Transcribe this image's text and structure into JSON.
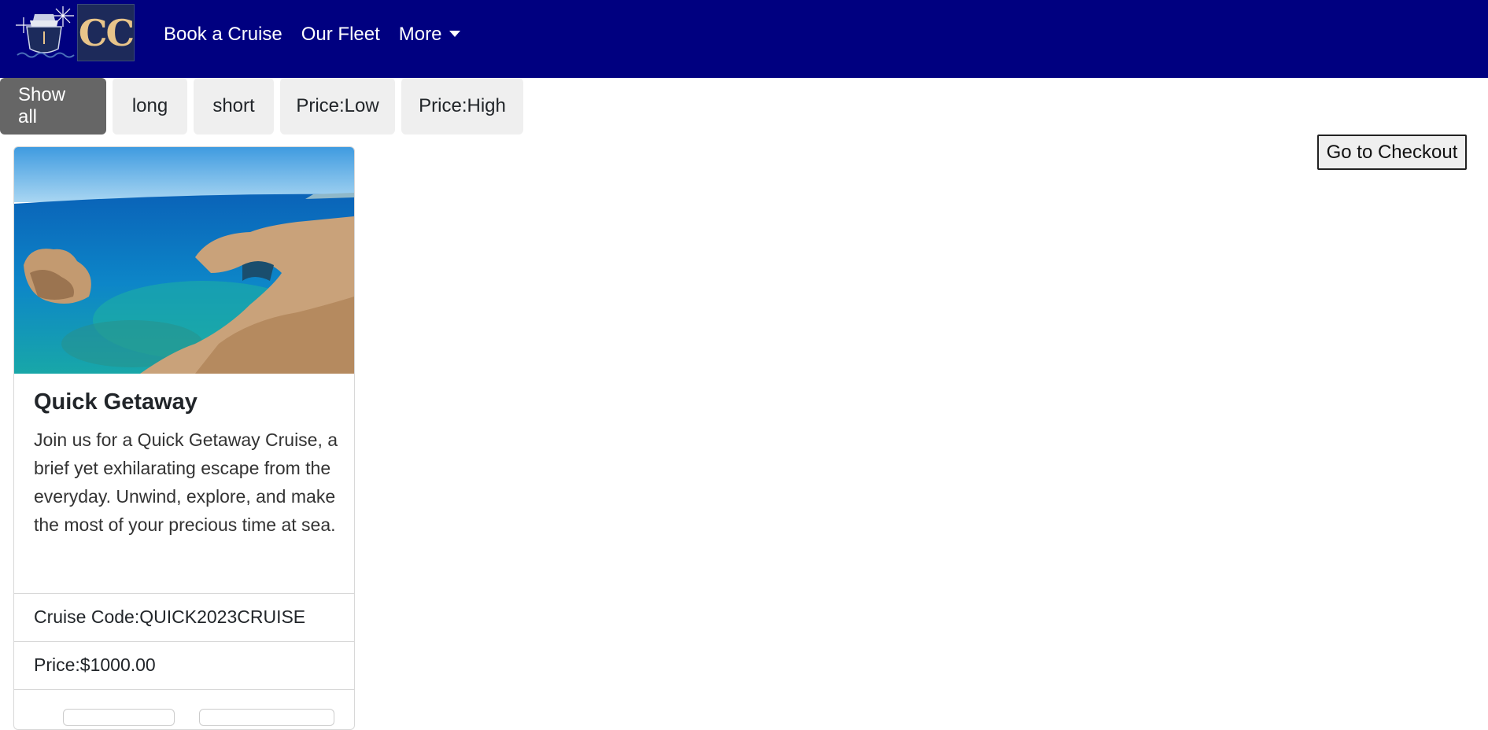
{
  "nav": {
    "brand_text": "CC",
    "links": [
      "Book a Cruise",
      "Our Fleet",
      "More"
    ],
    "bg_color": "#000080"
  },
  "filters": {
    "buttons": [
      "Show all",
      "long",
      "short",
      "Price:Low",
      "Price:High"
    ],
    "active": "Show all"
  },
  "checkout": {
    "label": "Go to Checkout"
  },
  "card": {
    "title": "Quick Getaway",
    "description": "Join us for a Quick Getaway Cruise, a brief yet exhilarating escape from the everyday. Unwind, explore, and make the most of your precious time at sea.",
    "code_label": "Cruise Code:",
    "code_value": "QUICK2023CRUISE",
    "price_label": "Price: ",
    "price_value": "$1000.00",
    "image_icon": "coastal-landscape-image"
  }
}
